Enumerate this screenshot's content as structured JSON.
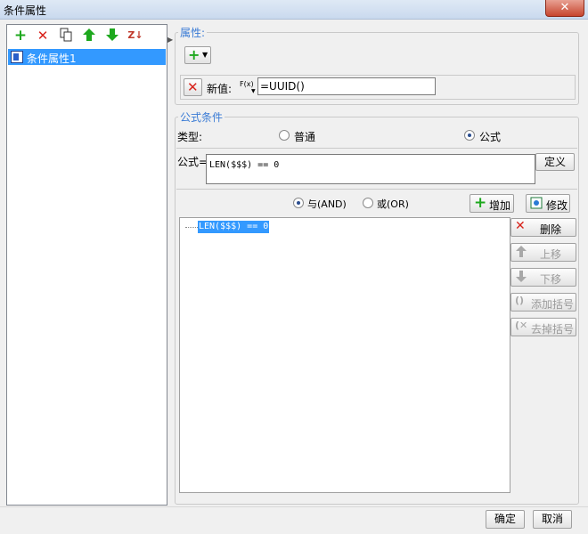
{
  "window": {
    "title": "条件属性",
    "close_label": "✕"
  },
  "left_toolbar": {
    "add_icon": "plus-icon",
    "delete_icon": "x-icon",
    "copy_icon": "copy-icon",
    "up_icon": "arrow-up-icon",
    "down_icon": "arrow-down-icon",
    "sort_icon": "sort-az-icon",
    "sort_label": "Z↓"
  },
  "tree": {
    "items": [
      {
        "label": "条件属性1"
      }
    ]
  },
  "properties": {
    "title": "属性:",
    "new_value_label": "新值:",
    "fx_label": "F(x)",
    "new_value": "=UUID()"
  },
  "formula": {
    "title": "公式条件",
    "type_label": "类型:",
    "option_normal": "普通",
    "option_formula": "公式",
    "selected": "公式",
    "formula_label": "公式=",
    "formula_value": "LEN($$$) == 0",
    "define_button": "定义",
    "and_label": "与(AND)",
    "or_label": "或(OR)",
    "logic_selected": "与(AND)",
    "add_button": "增加",
    "edit_button": "修改",
    "list": [
      "LEN($$$) == 0"
    ],
    "side_buttons": {
      "delete": "删除",
      "move_up": "上移",
      "move_down": "下移",
      "add_paren": "添加括号",
      "remove_paren": "去掉括号"
    }
  },
  "footer": {
    "ok": "确定",
    "cancel": "取消"
  },
  "colors": {
    "accent": "#3399ff",
    "group_title": "#3a7bd5",
    "green": "#1ea81e",
    "red": "#d8231b"
  }
}
